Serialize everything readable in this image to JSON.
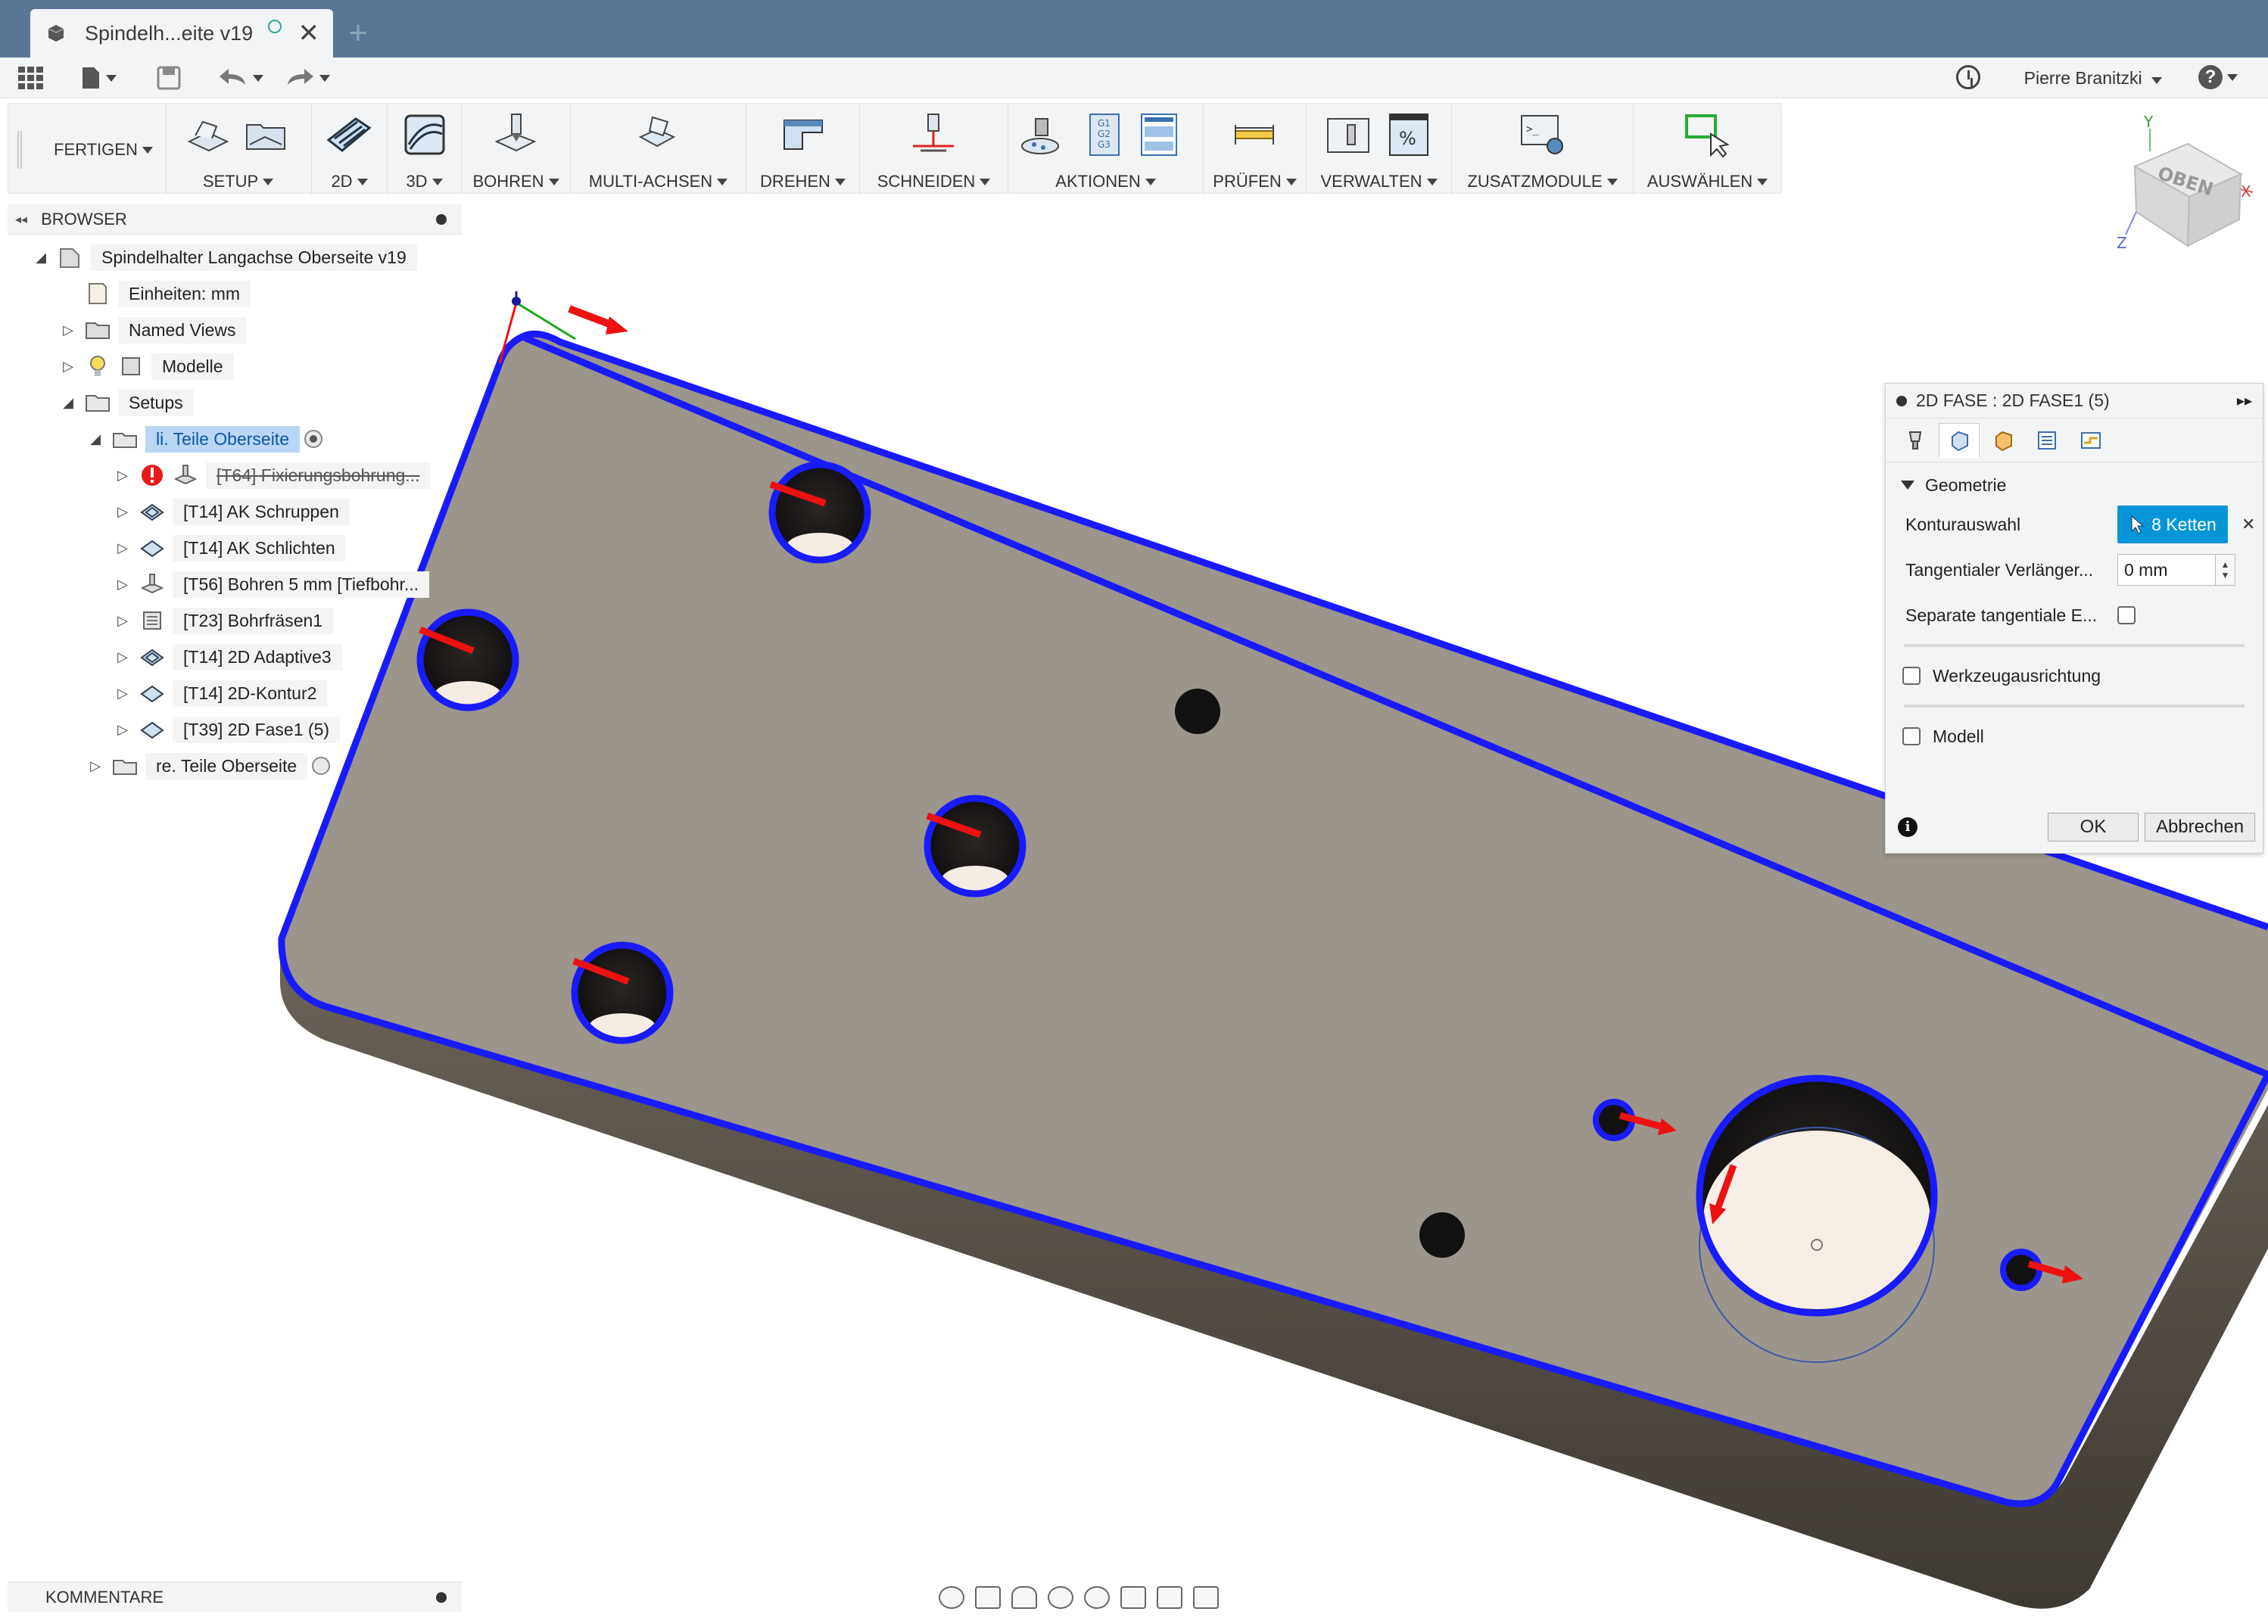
{
  "tab": {
    "title": "Spindelh...eite v19",
    "new_tab": "+",
    "close": "✕"
  },
  "user": {
    "name": "Pierre Branitzki",
    "help": "?"
  },
  "ribbon": {
    "workspace": "FERTIGEN",
    "groups": [
      {
        "label": "SETUP"
      },
      {
        "label": "2D"
      },
      {
        "label": "3D"
      },
      {
        "label": "BOHREN"
      },
      {
        "label": "MULTI-ACHSEN"
      },
      {
        "label": "DREHEN"
      },
      {
        "label": "SCHNEIDEN"
      },
      {
        "label": "AKTIONEN"
      },
      {
        "label": "PRÜFEN"
      },
      {
        "label": "VERWALTEN"
      },
      {
        "label": "ZUSATZMODULE"
      },
      {
        "label": "AUSWÄHLEN"
      }
    ]
  },
  "browser": {
    "title": "BROWSER",
    "items": [
      {
        "label": "Spindelhalter Langachse Oberseite v19"
      },
      {
        "label": "Einheiten: mm"
      },
      {
        "label": "Named Views"
      },
      {
        "label": "Modelle"
      },
      {
        "label": "Setups"
      },
      {
        "label": "li. Teile Oberseite"
      },
      {
        "label": "[T64] Fixierungsbohrung..."
      },
      {
        "label": "[T14] AK Schruppen"
      },
      {
        "label": "[T14] AK Schlichten"
      },
      {
        "label": "[T56] Bohren 5 mm [Tiefbohr..."
      },
      {
        "label": "[T23] Bohrfräsen1"
      },
      {
        "label": "[T14] 2D Adaptive3"
      },
      {
        "label": "[T14] 2D-Kontur2"
      },
      {
        "label": "[T39] 2D Fase1 (5)"
      },
      {
        "label": "re. Teile Oberseite"
      }
    ]
  },
  "comments": {
    "title": "KOMMENTARE"
  },
  "viewcube": {
    "face": "OBEN",
    "axis_x": "X",
    "axis_y": "Y",
    "axis_z": "Z"
  },
  "dialog": {
    "title": "2D FASE : 2D FASE1 (5)",
    "section": "Geometrie",
    "contour_label": "Konturauswahl",
    "contour_value": "8 Ketten",
    "tangential_label": "Tangentialer Verlänger...",
    "tangential_value": "0 mm",
    "separate_label": "Separate tangentiale E...",
    "tool_orientation": "Werkzeugausrichtung",
    "model": "Modell",
    "ok": "OK",
    "cancel": "Abbrechen"
  },
  "colors": {
    "accent": "#0696d7",
    "selection": "#1a1aff",
    "part_top": "#9b958b",
    "part_side": "#58524a",
    "arrow": "#ee1111",
    "tabbar": "#5a7595"
  }
}
